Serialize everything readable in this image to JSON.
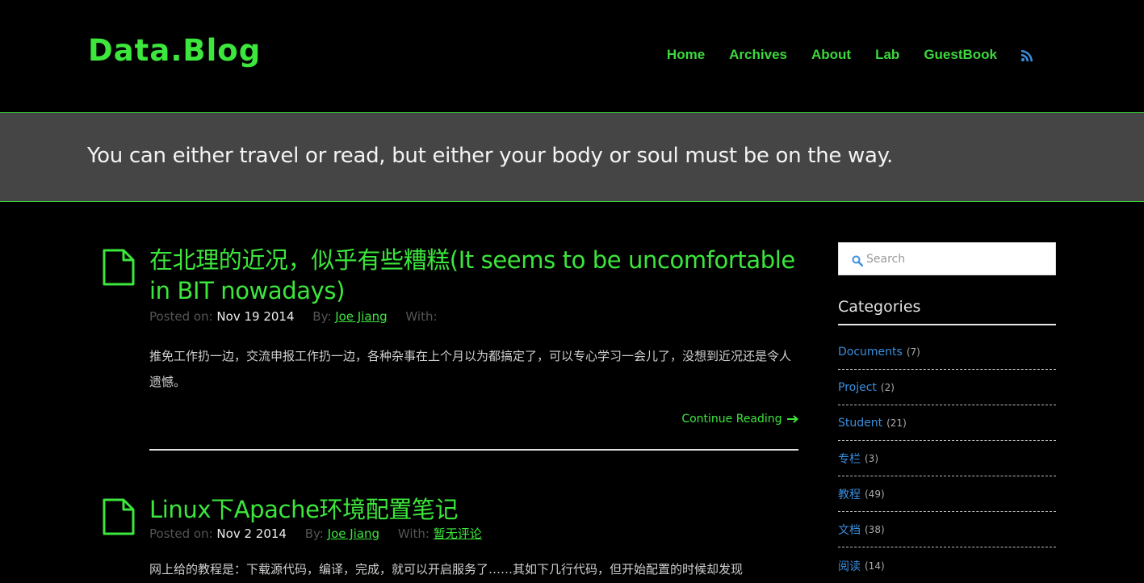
{
  "site": {
    "logo": "Data.Blog",
    "nav": [
      {
        "label": "Home"
      },
      {
        "label": "Archives"
      },
      {
        "label": "About"
      },
      {
        "label": "Lab"
      },
      {
        "label": "GuestBook"
      }
    ],
    "rss_icon": "rss-icon",
    "accent_color": "#3ce63c",
    "link_color": "#3a8fe0"
  },
  "banner": {
    "tagline": "You can either travel or read, but either your body or soul must be on the way."
  },
  "posts": [
    {
      "title": "在北理的近况，似乎有些糟糕(It seems to be uncomfortable in BIT nowadays)",
      "posted_label": "Posted on:",
      "date": "Nov 19 2014",
      "by_label": "By:",
      "author": "Joe Jiang",
      "with_label": "With:",
      "comments": "",
      "excerpt": "推免工作扔一边，交流申报工作扔一边，各种杂事在上个月以为都搞定了，可以专心学习一会儿了，没想到近况还是令人遗憾。",
      "continue": "Continue Reading"
    },
    {
      "title": "Linux下Apache环境配置笔记",
      "posted_label": "Posted on:",
      "date": "Nov 2 2014",
      "by_label": "By:",
      "author": "Joe Jiang",
      "with_label": "With:",
      "comments": "暂无评论",
      "excerpt": "网上给的教程是：下载源代码，编译，完成，就可以开启服务了……其如下几行代码，但开始配置的时候却发现"
    }
  ],
  "sidebar": {
    "search_placeholder": "Search",
    "categories_title": "Categories",
    "categories": [
      {
        "name": "Documents",
        "count": "(7)"
      },
      {
        "name": "Project",
        "count": "(2)"
      },
      {
        "name": "Student",
        "count": "(21)"
      },
      {
        "name": "专栏",
        "count": "(3)"
      },
      {
        "name": "教程",
        "count": "(49)"
      },
      {
        "name": "文档",
        "count": "(38)"
      },
      {
        "name": "阅读",
        "count": "(14)"
      }
    ]
  }
}
